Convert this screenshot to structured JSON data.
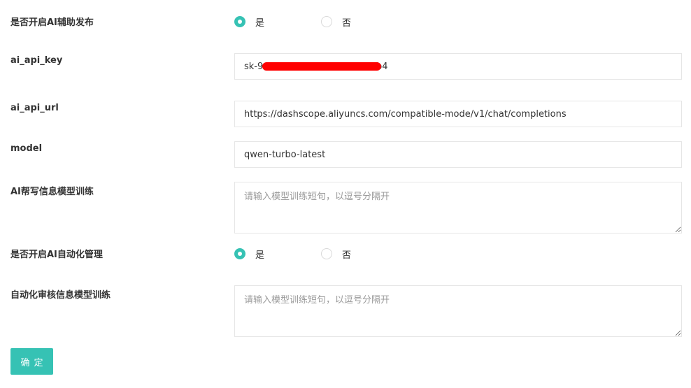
{
  "form": {
    "ai_publish": {
      "label": "是否开启AI辅助发布",
      "options": [
        "是",
        "否"
      ],
      "selected": "是"
    },
    "ai_api_key": {
      "label": "ai_api_key",
      "value": "sk-9                               f2f8ab4"
    },
    "ai_api_url": {
      "label": "ai_api_url",
      "value": "https://dashscope.aliyuncs.com/compatible-mode/v1/chat/completions"
    },
    "model": {
      "label": "model",
      "value": "qwen-turbo-latest"
    },
    "ai_write_training": {
      "label": "AI帮写信息模型训练",
      "placeholder": "请输入模型训练短句，以逗号分隔开"
    },
    "ai_auto_manage": {
      "label": "是否开启AI自动化管理",
      "options": [
        "是",
        "否"
      ],
      "selected": "是"
    },
    "auto_review_training": {
      "label": "自动化审核信息模型训练",
      "placeholder": "请输入模型训练短句，以逗号分隔开"
    },
    "submit_label": "确定"
  },
  "colors": {
    "accent": "#36c2b4",
    "redaction": "#ff0000",
    "border": "#e6e6e6"
  }
}
